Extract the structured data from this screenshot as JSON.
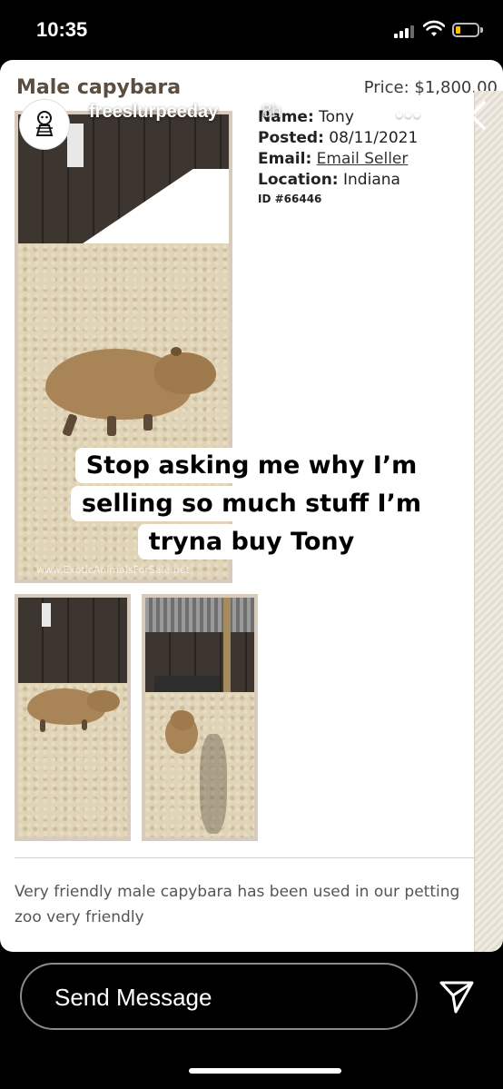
{
  "status_bar": {
    "time": "10:35",
    "signal_icon": "cellular-signal-icon",
    "wifi_icon": "wifi-icon",
    "battery_icon": "battery-low-icon",
    "battery_color": "#f5c400"
  },
  "story": {
    "username": "freeslurpeeday",
    "timestamp": "8h",
    "more_icon": "more-dots-icon",
    "close_icon": "close-icon",
    "caption_lines": [
      "Stop asking me why I’m",
      "selling so much stuff I’m",
      "tryna buy Tony"
    ]
  },
  "listing": {
    "title": "Male capybara",
    "price": "Price: $1,800.00",
    "name_label": "Name:",
    "name_value": "Tony",
    "posted_label": "Posted:",
    "posted_value": "08/11/2021",
    "email_label": "Email:",
    "email_value": "Email Seller",
    "location_label": "Location:",
    "location_value": "Indiana",
    "id": "ID #66446",
    "watermark": "www.ExoticAnimalsForSale.net",
    "description": "Very friendly male capybara has been used in our petting zoo very friendly"
  },
  "bottom_bar": {
    "send_placeholder": "Send Message",
    "direct_icon": "paper-plane-icon"
  }
}
